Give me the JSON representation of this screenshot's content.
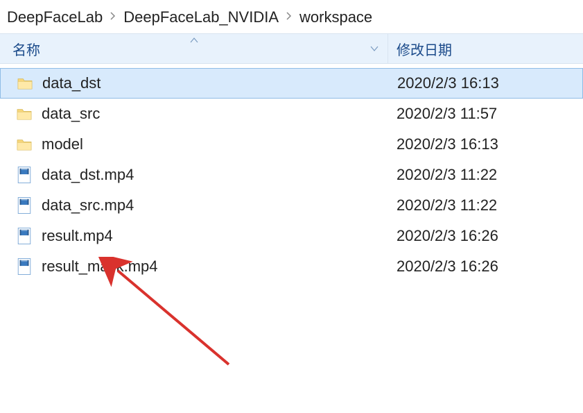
{
  "breadcrumb": {
    "items": [
      "DeepFaceLab",
      "DeepFaceLab_NVIDIA",
      "workspace"
    ]
  },
  "columns": {
    "name_label": "名称",
    "date_label": "修改日期"
  },
  "files": [
    {
      "name": "data_dst",
      "date": "2020/2/3 16:13",
      "type": "folder",
      "selected": true
    },
    {
      "name": "data_src",
      "date": "2020/2/3 11:57",
      "type": "folder",
      "selected": false
    },
    {
      "name": "model",
      "date": "2020/2/3 16:13",
      "type": "folder",
      "selected": false
    },
    {
      "name": "data_dst.mp4",
      "date": "2020/2/3 11:22",
      "type": "video",
      "selected": false
    },
    {
      "name": "data_src.mp4",
      "date": "2020/2/3 11:22",
      "type": "video",
      "selected": false
    },
    {
      "name": "result.mp4",
      "date": "2020/2/3 16:26",
      "type": "video",
      "selected": false
    },
    {
      "name": "result_mask.mp4",
      "date": "2020/2/3 16:26",
      "type": "video",
      "selected": false
    }
  ]
}
